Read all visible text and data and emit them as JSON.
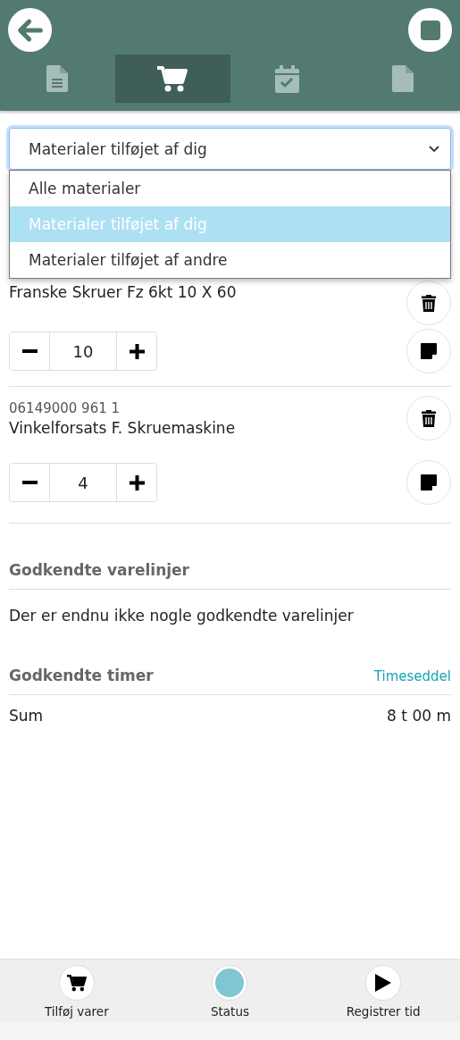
{
  "tabs": [
    {
      "kind": "document",
      "selected": false
    },
    {
      "kind": "cart",
      "selected": true
    },
    {
      "kind": "calendar",
      "selected": false
    },
    {
      "kind": "file",
      "selected": false
    }
  ],
  "filter": {
    "value": "Materialer tilføjet af dig",
    "expanded": true,
    "options": [
      {
        "label": "Alle materialer",
        "selected": false
      },
      {
        "label": "Materialer tilføjet af dig",
        "selected": true
      },
      {
        "label": "Materialer tilføjet af andre",
        "selected": false
      }
    ]
  },
  "materials": [
    {
      "name": "Franske Skruer Fz 6kt 10 X 60",
      "quantity": "10"
    },
    {
      "code": "06149000 961 1",
      "name": "Vinkelforsats F. Skruemaskine",
      "quantity": "4"
    }
  ],
  "approved_lines": {
    "title": "Godkendte varelinjer",
    "empty_text": "Der er endnu ikke nogle godkendte varelinjer"
  },
  "approved_hours": {
    "title": "Godkendte timer",
    "link": "Timeseddel",
    "sum_label": "Sum",
    "sum_value": "8 t 00 m"
  },
  "bottom_bar": [
    {
      "kind": "cart",
      "label": "Tilføj varer"
    },
    {
      "kind": "status",
      "label": "Status",
      "color": "#80c5d3"
    },
    {
      "kind": "play",
      "label": "Registrer tid"
    }
  ]
}
